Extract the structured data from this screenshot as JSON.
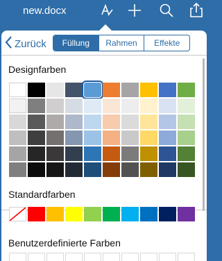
{
  "header": {
    "title": "new.docx",
    "icons": [
      "text-format-icon",
      "add-icon",
      "search-icon",
      "share-icon"
    ]
  },
  "panel": {
    "back_label": "Zurück",
    "tabs": [
      {
        "label": "Füllung",
        "active": true
      },
      {
        "label": "Rahmen",
        "active": false
      },
      {
        "label": "Effekte",
        "active": false
      }
    ]
  },
  "sections": {
    "design_colors_title": "Designfarben",
    "standard_colors_title": "Standardfarben",
    "custom_colors_title": "Benutzerdefinierte Farben"
  },
  "colors": {
    "accent": "#2e6da8",
    "theme_rows": [
      [
        "#ffffff",
        "#000000",
        "#e7e6e6",
        "#44546a",
        "#5b9bd5",
        "#ed7d31",
        "#a5a5a5",
        "#ffc000",
        "#4472c4",
        "#70ad47"
      ],
      [
        "#f2f2f2",
        "#7f7f7f",
        "#d0cece",
        "#d6dce4",
        "#deebf6",
        "#fbe5d5",
        "#ededed",
        "#fff2cc",
        "#d9e2f3",
        "#e2efd9"
      ],
      [
        "#d8d8d8",
        "#595959",
        "#aeaaaa",
        "#adb9ca",
        "#bdd7ee",
        "#f7cbac",
        "#dbdbdb",
        "#fee599",
        "#b4c6e7",
        "#c5e0b3"
      ],
      [
        "#bfbfbf",
        "#3f3f3f",
        "#757070",
        "#8496b0",
        "#9cc3e5",
        "#f4b183",
        "#c9c9c9",
        "#ffd965",
        "#8eaadb",
        "#a8d08d"
      ],
      [
        "#a5a5a5",
        "#262626",
        "#3a3838",
        "#323f4f",
        "#2e75b5",
        "#c55a11",
        "#7b7b7b",
        "#bf9000",
        "#2f5496",
        "#538135"
      ],
      [
        "#7f7f7f",
        "#0c0c0c",
        "#171616",
        "#222a35",
        "#1e4e79",
        "#843c0b",
        "#525252",
        "#7f6000",
        "#1f3864",
        "#375623"
      ]
    ],
    "standard": [
      "none",
      "#ff0000",
      "#ffc000",
      "#ffff00",
      "#92d050",
      "#00b050",
      "#00b0f0",
      "#0070c0",
      "#002060",
      "#7030a0"
    ],
    "selected": {
      "row": 0,
      "col": 4
    }
  }
}
